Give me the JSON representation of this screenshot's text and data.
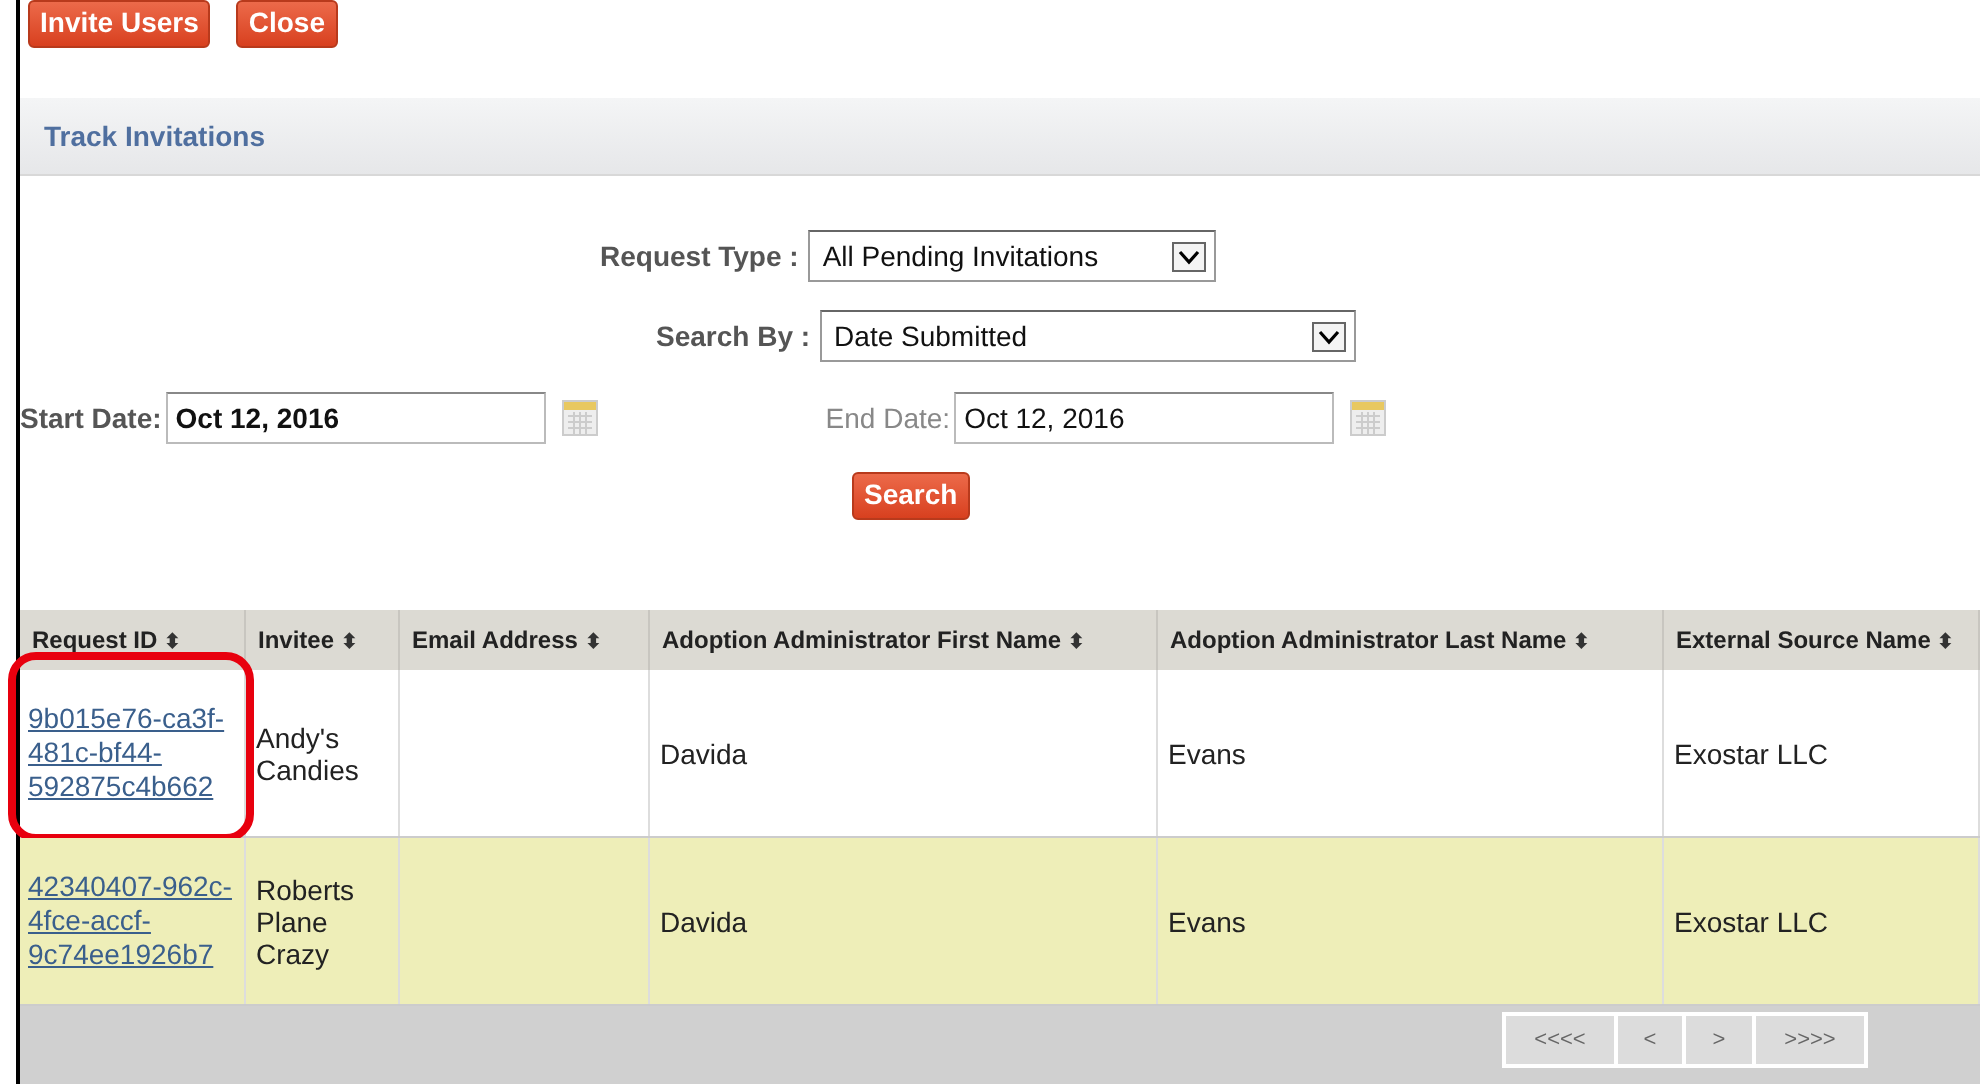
{
  "buttons": [
    {
      "label": "Invite Users"
    },
    {
      "label": "Close"
    }
  ],
  "section_title": "Track Invitations",
  "form": {
    "request_type": {
      "label": "Request Type :",
      "value": "All Pending Invitations"
    },
    "search_by": {
      "label": "Search By :",
      "value": "Date Submitted"
    },
    "start_date": {
      "label": "Start Date:",
      "value": "Oct 12, 2016"
    },
    "end_date": {
      "label": "End Date:",
      "value": "Oct 12, 2016"
    },
    "search_button": "Search"
  },
  "table": {
    "columns": [
      {
        "label": "Request ID",
        "sort": "⬍"
      },
      {
        "label": "Invitee",
        "sort": "⬍"
      },
      {
        "label": "Email Address",
        "sort": "⬍"
      },
      {
        "label": "Adoption Administrator First Name",
        "sort": "⬍"
      },
      {
        "label": "Adoption Administrator Last Name",
        "sort": "⬍"
      },
      {
        "label": "External Source Name",
        "sort": "⬍"
      }
    ],
    "rows": [
      {
        "request_id": "9b015e76-ca3f-481c-bf44-592875c4b662",
        "invitee": "Andy's Candies",
        "email": "",
        "first_name": "Davida",
        "last_name": "Evans",
        "source": "Exostar LLC",
        "highlighted": true
      },
      {
        "request_id": "42340407-962c-4fce-accf-9c74ee1926b7",
        "invitee": "Roberts Plane Crazy",
        "email": "",
        "first_name": "Davida",
        "last_name": "Evans",
        "source": "Exostar LLC",
        "highlighted": false
      }
    ]
  },
  "pager": [
    "<<<<",
    "<",
    ">",
    ">>>>"
  ]
}
